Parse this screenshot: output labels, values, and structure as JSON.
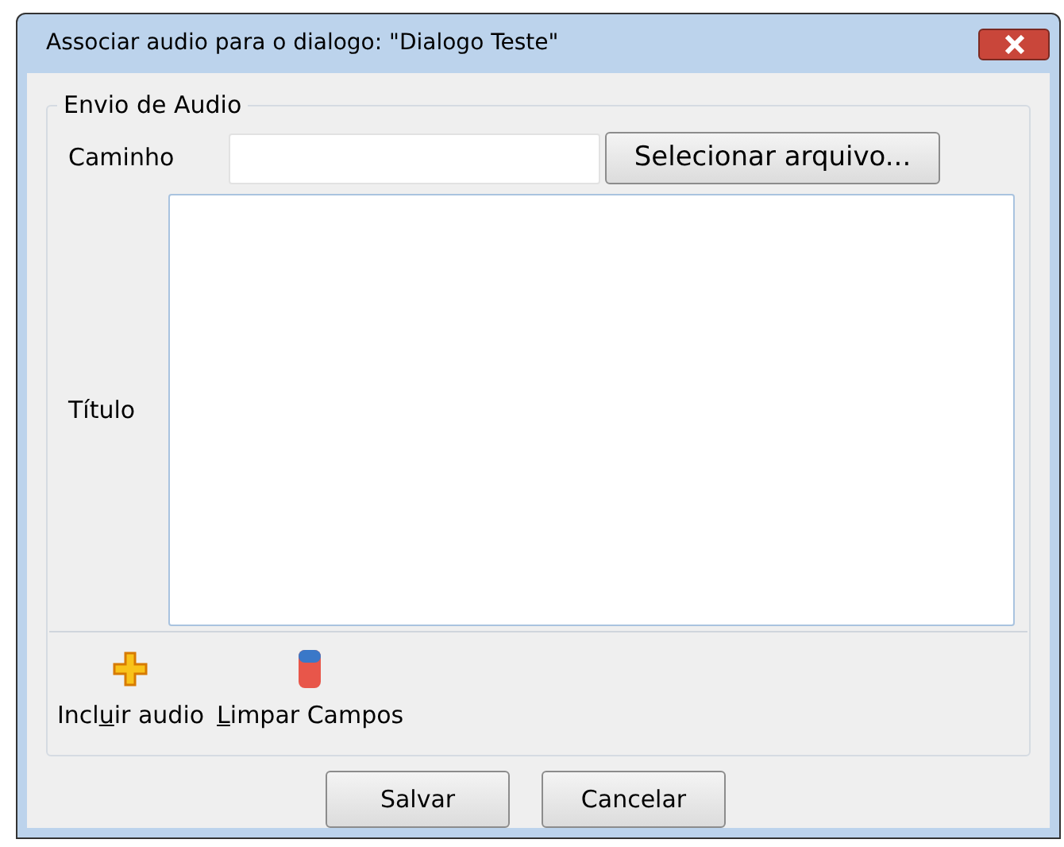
{
  "window": {
    "title": "Associar audio para o dialogo: \"Dialogo Teste\""
  },
  "group": {
    "legend": "Envio de Audio",
    "path": {
      "label": "Caminho"
    },
    "browse_button": "Selecionar arquivo...",
    "title_field": {
      "label": "Título"
    },
    "actions": [
      {
        "kind": "add",
        "before": "Incl",
        "mnemonic": "u",
        "after": "ir audio"
      },
      {
        "kind": "clear",
        "mnemonic": "L",
        "after": "impar Campos"
      }
    ]
  },
  "buttons": [
    "Salvar",
    "Cancelar"
  ]
}
